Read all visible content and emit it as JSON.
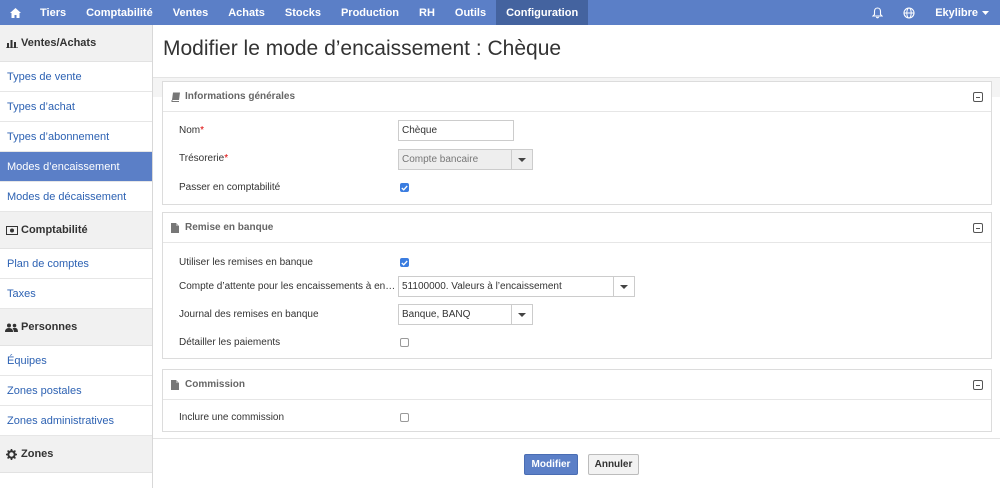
{
  "topbar": {
    "nav": [
      "Tiers",
      "Comptabilité",
      "Ventes",
      "Achats",
      "Stocks",
      "Production",
      "RH",
      "Outils",
      "Configuration"
    ],
    "active": "Configuration",
    "user": "Ekylibre",
    "accent": "#5b7fc7",
    "active_bg": "#44639f"
  },
  "sidebar": {
    "sections": [
      {
        "title": "Ventes/Achats",
        "icon": "bar-chart-icon",
        "items": [
          "Types de vente",
          "Types d’achat",
          "Types d’abonnement",
          "Modes d’encaissement",
          "Modes de décaissement"
        ]
      },
      {
        "title": "Comptabilité",
        "icon": "money-icon",
        "items": [
          "Plan de comptes",
          "Taxes"
        ]
      },
      {
        "title": "Personnes",
        "icon": "users-icon",
        "items": [
          "Équipes",
          "Zones postales",
          "Zones administratives"
        ]
      },
      {
        "title": "Zones",
        "icon": "gear-icon",
        "items": []
      }
    ],
    "active_item": "Modes d’encaissement"
  },
  "page": {
    "title": "Modifier le mode d’encaissement : Chèque"
  },
  "general": {
    "heading": "Informations générales",
    "name_label": "Nom",
    "name_value": "Chèque",
    "cash_label": "Trésorerie",
    "cash_value": "Compte bancaire",
    "bookkeep_label": "Passer en comptabilité",
    "bookkeep_checked": true
  },
  "deposit": {
    "heading": "Remise en banque",
    "use_label": "Utiliser les remises en banque",
    "use_checked": true,
    "account_label": "Compte d’attente pour les encaissements à en…",
    "account_value": "51100000. Valeurs à l’encaissement",
    "journal_label": "Journal des remises en banque",
    "journal_value": "Banque, BANQ",
    "detail_label": "Détailler les paiements",
    "detail_checked": false
  },
  "commission": {
    "heading": "Commission",
    "include_label": "Inclure une commission",
    "include_checked": false
  },
  "actions": {
    "submit": "Modifier",
    "cancel": "Annuler"
  }
}
